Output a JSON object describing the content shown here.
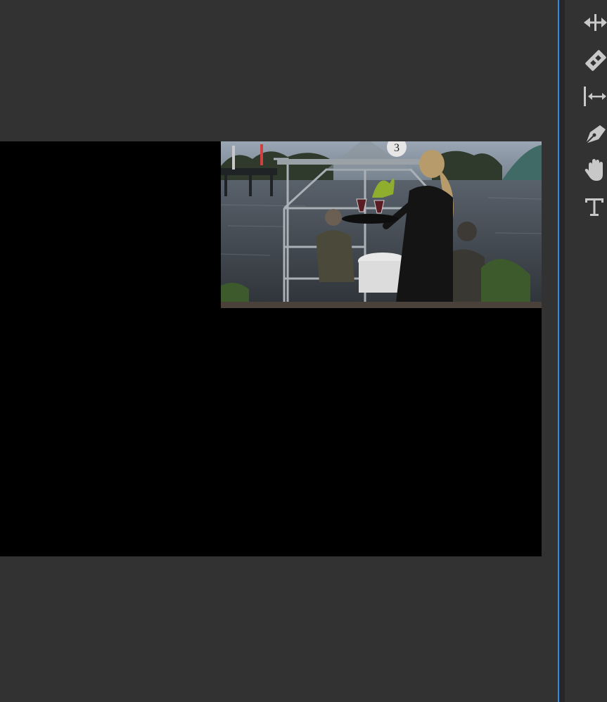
{
  "app": {
    "name": "video-editor"
  },
  "program_monitor": {
    "clip": {
      "content": "greenhouse-dinner-scene",
      "table_number": "3"
    },
    "colors": {
      "canvas_background": "#000000",
      "panel_background": "#323232",
      "panel_divider": "#2e8ae6"
    }
  },
  "tools": [
    {
      "name": "track-select-forward",
      "icon": "track-select-icon"
    },
    {
      "name": "razor",
      "icon": "razor-icon"
    },
    {
      "name": "slip",
      "icon": "slip-icon"
    },
    {
      "name": "pen",
      "icon": "pen-icon"
    },
    {
      "name": "hand",
      "icon": "hand-icon"
    },
    {
      "name": "type",
      "icon": "type-icon"
    }
  ]
}
